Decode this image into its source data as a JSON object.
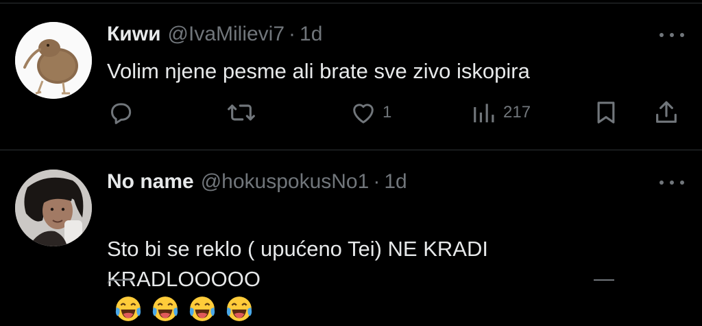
{
  "tweets": [
    {
      "display_name": "Киwи",
      "handle": "@IvaMilievi7",
      "separator": "·",
      "time": "1d",
      "text": "Volim njene pesme ali brate sve zivo iskopira",
      "actions": {
        "replies": "",
        "reposts": "",
        "likes": "1",
        "views": "217"
      },
      "avatar_icon": "kiwi-plush-avatar"
    },
    {
      "display_name": "No name",
      "handle": "@hokuspokusNo1",
      "separator": "·",
      "time": "1d",
      "text": "Sto bi se reklo ( upućeno Tei) NE KRADI\nKRADLOOOOO",
      "emoji_icon": "tears-of-joy-emoji",
      "emoji_count": 4,
      "avatar_icon": "person-photo-avatar"
    }
  ],
  "colors": {
    "background": "#000000",
    "primary_text": "#e7e9ea",
    "secondary_text": "#71767b",
    "divider": "#2f3336"
  }
}
